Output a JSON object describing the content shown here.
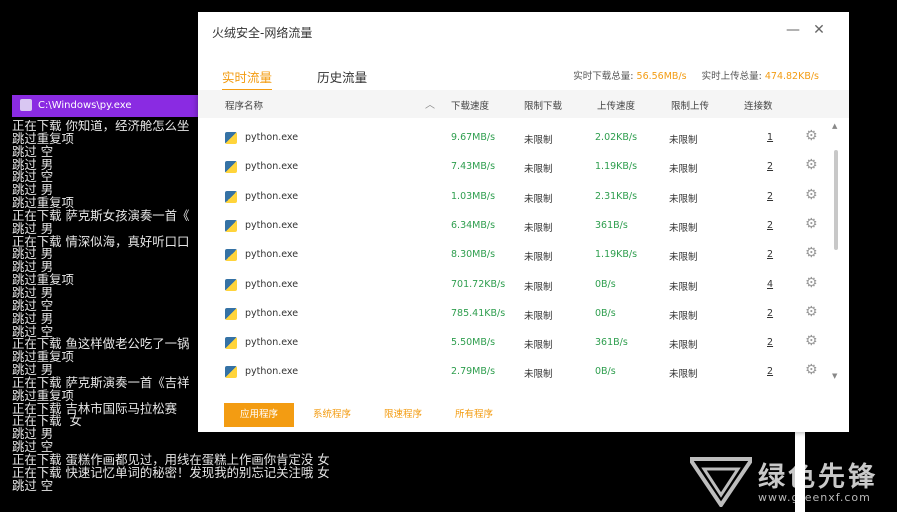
{
  "console": {
    "title": "C:\\Windows\\py.exe",
    "lines": [
      "正在下载 你知道，经济舱怎么坐",
      "跳过重复项",
      "跳过 空",
      "跳过 男",
      "跳过 空",
      "跳过 男",
      "跳过重复项",
      "正在下载 萨克斯女孩演奏一首《",
      "跳过 男",
      "正在下载 情深似海，真好听口口",
      "跳过 男",
      "跳过 男",
      "跳过重复项",
      "跳过 男",
      "跳过 空",
      "跳过 男",
      "跳过 空",
      "正在下载 鱼这样做老公吃了一锅",
      "跳过重复项",
      "跳过 男",
      "正在下载 萨克斯演奏一首《吉祥",
      "跳过重复项",
      "正在下载 吉林市国际马拉松赛 ",
      "正在下载  女",
      "跳过 男",
      "跳过 空",
      "正在下载 蛋糕作画都见过，用线在蛋糕上作画你肯定没 女",
      "正在下载 快速记忆单词的秘密！发现我的别忘记关注哦 女",
      "跳过 空"
    ]
  },
  "dialog": {
    "title": "火绒安全-网络流量",
    "minimize": "—",
    "close": "✕",
    "tabs": [
      "实时流量",
      "历史流量"
    ],
    "realtime_download_label": "实时下载总量:",
    "realtime_download_value": "56.56MB/s",
    "realtime_upload_label": "实时上传总量:",
    "realtime_upload_value": "474.82KB/s",
    "columns": {
      "name": "程序名称",
      "download_speed": "下载速度",
      "limit_download": "限制下载",
      "upload_speed": "上传速度",
      "limit_upload": "限制上传",
      "connections": "连接数"
    },
    "rows": [
      {
        "name": "python.exe",
        "dl": "9.67MB/s",
        "ldl": "未限制",
        "ul": "2.02KB/s",
        "lul": "未限制",
        "conn": "1"
      },
      {
        "name": "python.exe",
        "dl": "7.43MB/s",
        "ldl": "未限制",
        "ul": "1.19KB/s",
        "lul": "未限制",
        "conn": "2"
      },
      {
        "name": "python.exe",
        "dl": "1.03MB/s",
        "ldl": "未限制",
        "ul": "2.31KB/s",
        "lul": "未限制",
        "conn": "2"
      },
      {
        "name": "python.exe",
        "dl": "6.34MB/s",
        "ldl": "未限制",
        "ul": "361B/s",
        "lul": "未限制",
        "conn": "2"
      },
      {
        "name": "python.exe",
        "dl": "8.30MB/s",
        "ldl": "未限制",
        "ul": "1.19KB/s",
        "lul": "未限制",
        "conn": "2"
      },
      {
        "name": "python.exe",
        "dl": "701.72KB/s",
        "ldl": "未限制",
        "ul": "0B/s",
        "lul": "未限制",
        "conn": "4"
      },
      {
        "name": "python.exe",
        "dl": "785.41KB/s",
        "ldl": "未限制",
        "ul": "0B/s",
        "lul": "未限制",
        "conn": "2"
      },
      {
        "name": "python.exe",
        "dl": "5.50MB/s",
        "ldl": "未限制",
        "ul": "361B/s",
        "lul": "未限制",
        "conn": "2"
      },
      {
        "name": "python.exe",
        "dl": "2.79MB/s",
        "ldl": "未限制",
        "ul": "0B/s",
        "lul": "未限制",
        "conn": "2"
      }
    ],
    "bottom_tabs": [
      "应用程序",
      "系统程序",
      "限速程序",
      "所有程序"
    ]
  },
  "watermark": {
    "text": "绿色先锋",
    "url": "www.greenxf.com"
  },
  "colors": {
    "accent": "#f39c12",
    "speed_green": "#2e9e4e",
    "console_title_bg": "#8a2be2"
  }
}
